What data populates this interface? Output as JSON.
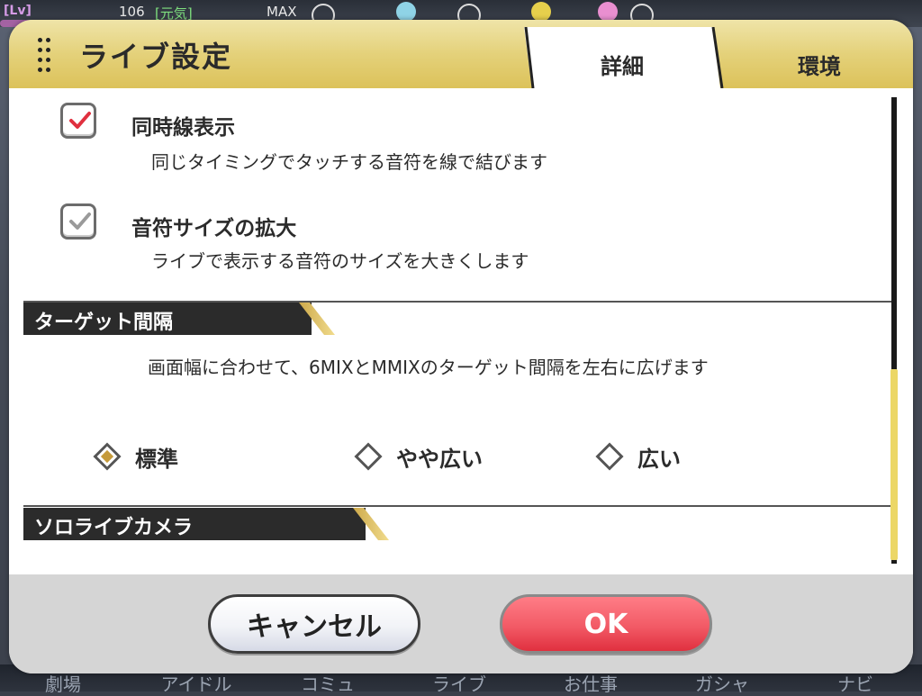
{
  "background": {
    "level_label": "[Lv]",
    "level_value": "106",
    "genki_label": "[元気]",
    "max_label": "MAX",
    "nav": [
      "劇場",
      "アイドル",
      "コミュ",
      "ライブ",
      "お仕事",
      "ガシャ",
      "ナビ"
    ]
  },
  "dialog": {
    "title": "ライブ設定",
    "tabs": [
      {
        "label": "詳細",
        "active": true
      },
      {
        "label": "環境",
        "active": false
      }
    ]
  },
  "options": [
    {
      "title": "同時線表示",
      "description": "同じタイミングでタッチする音符を線で結びます",
      "checked": true,
      "check_color": "#e0303f"
    },
    {
      "title": "音符サイズの拡大",
      "description": "ライブで表示する音符のサイズを大きくします",
      "checked": true,
      "check_color": "#9a9a9a"
    }
  ],
  "target_spacing": {
    "heading": "ターゲット間隔",
    "description": "画面幅に合わせて、6MIXとMMIXのターゲット間隔を左右に広げます",
    "choices": [
      {
        "label": "標準",
        "selected": true
      },
      {
        "label": "やや広い",
        "selected": false
      },
      {
        "label": "広い",
        "selected": false
      }
    ]
  },
  "solo_camera": {
    "heading": "ソロライブカメラ"
  },
  "buttons": {
    "cancel": "キャンセル",
    "ok": "OK"
  },
  "colors": {
    "header_gold": "#e4d17a",
    "ok_red": "#f25a66",
    "scroll_thumb": "#ecd766"
  }
}
